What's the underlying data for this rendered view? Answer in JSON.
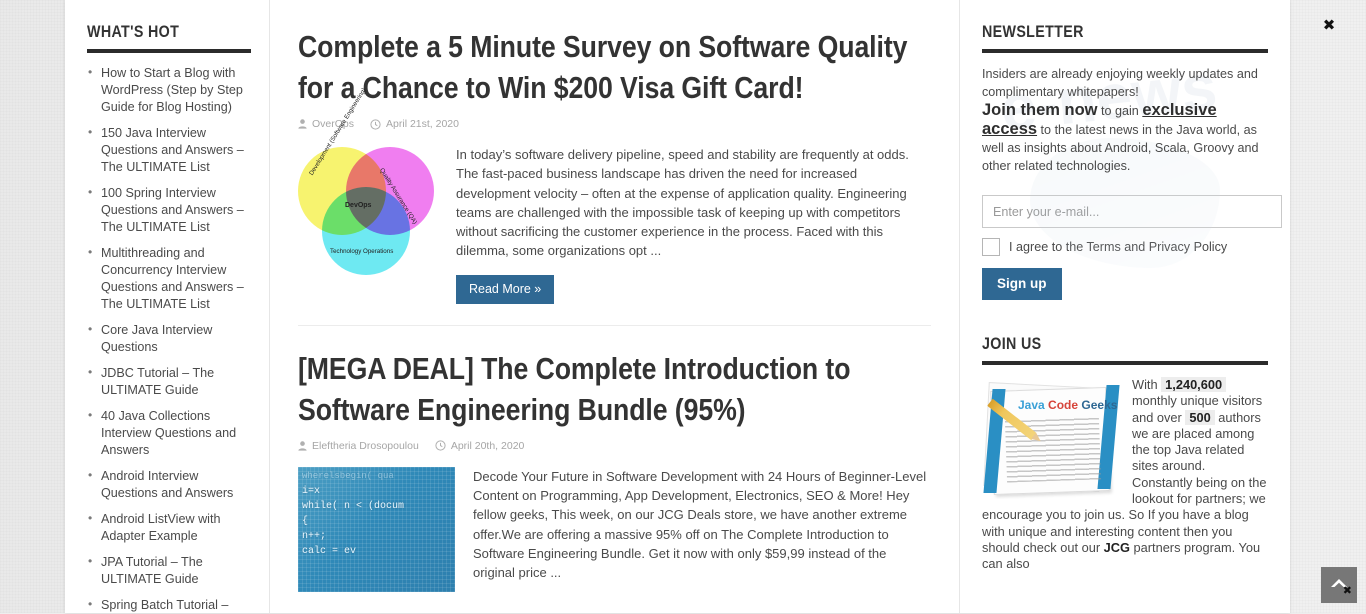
{
  "sidebar_left": {
    "title": "WHAT'S HOT",
    "items": [
      "How to Start a Blog with WordPress (Step by Step Guide for Blog Hosting)",
      "150 Java Interview Questions and Answers – The ULTIMATE List",
      "100 Spring Interview Questions and Answers – The ULTIMATE List",
      "Multithreading and Concurrency Interview Questions and Answers – The ULTIMATE List",
      "Core Java Interview Questions",
      "JDBC Tutorial – The ULTIMATE Guide",
      "40 Java Collections Interview Questions and Answers",
      "Android Interview Questions and Answers",
      "Android ListView with Adapter Example",
      "JPA Tutorial – The ULTIMATE Guide",
      "Spring Batch Tutorial –"
    ]
  },
  "posts": [
    {
      "title": "Complete a 5 Minute Survey on Software Quality for a Chance to Win $200 Visa Gift Card!",
      "author": "OverOps",
      "date": "April 21st, 2020",
      "excerpt": "In today’s software delivery pipeline, speed and stability are frequently at odds. The fast-paced business landscape has driven the need for increased development velocity – often at the expense of application quality. Engineering teams are challenged with the impossible task of keeping up with competitors without sacrificing the customer experience in the process. Faced with this dilemma, some organizations opt ...",
      "read_more": "Read More »",
      "thumb": {
        "kind": "venn-diagram",
        "labels": {
          "development": "Development (Software Engineering)",
          "quality": "Quality Assurance (QA)",
          "operations": "Technology Operations",
          "center": "DevOps"
        },
        "colors": {
          "development": "#f7f36f",
          "quality": "#f07ef0",
          "operations": "#6ee9f2"
        }
      }
    },
    {
      "title": "[MEGA DEAL] The Complete Introduction to Software Engineering Bundle (95%)",
      "author": "Eleftheria Drosopoulou",
      "date": "April 20th, 2020",
      "excerpt": "Decode Your Future in Software Development with 24 Hours of Beginner-Level Content on Programming, App Development, Electronics, SEO & More! Hey fellow geeks, This week, on our JCG Deals store, we have another extreme offer.We are offering a massive 95% off on The Complete Introduction to Software Engineering Bundle. Get it now with only $59,99 instead of the original price ...",
      "thumb": {
        "kind": "code-photo",
        "lines": [
          "wherelsbegin( qua",
          "i=x",
          "",
          "while( n < (docum",
          "{",
          "        n++;",
          "        calc = ev"
        ]
      }
    }
  ],
  "newsletter": {
    "title": "NEWSLETTER",
    "intro": "Insiders are already enjoying weekly updates and complimentary whitepapers!",
    "join_strong": "Join them now",
    "join_mid": " to gain ",
    "join_underline": "exclusive access",
    "join_tail": " to the latest news in the Java world, as well as insights about Android, Scala, Groovy and other related technologies.",
    "email_placeholder": "Enter your e-mail...",
    "email_value": "",
    "agree_label": "I agree to the Terms and Privacy Policy",
    "signup_label": "Sign up",
    "watermark": "e-news"
  },
  "joinus": {
    "title": "JOIN US",
    "text_1": "With ",
    "visitors": "1,240,600",
    "text_2": " monthly unique visitors and over ",
    "authors": "500",
    "text_3": " authors we are placed among the top Java related sites around. Constantly being on the lookout for partners; we encourage you to join us. So If you have a blog with unique and interesting content then you should check out our ",
    "jcg": "JCG",
    "text_4": " partners program. You can also",
    "image_caption": "Java Code Geeks"
  },
  "controls": {
    "close_label": "✖",
    "to_top_label": "scroll to top",
    "to_top_x": "✖"
  },
  "colors": {
    "accent_blue": "#2f6893",
    "rule_dark": "#2b2b2b",
    "text": "#4a4a4a"
  }
}
